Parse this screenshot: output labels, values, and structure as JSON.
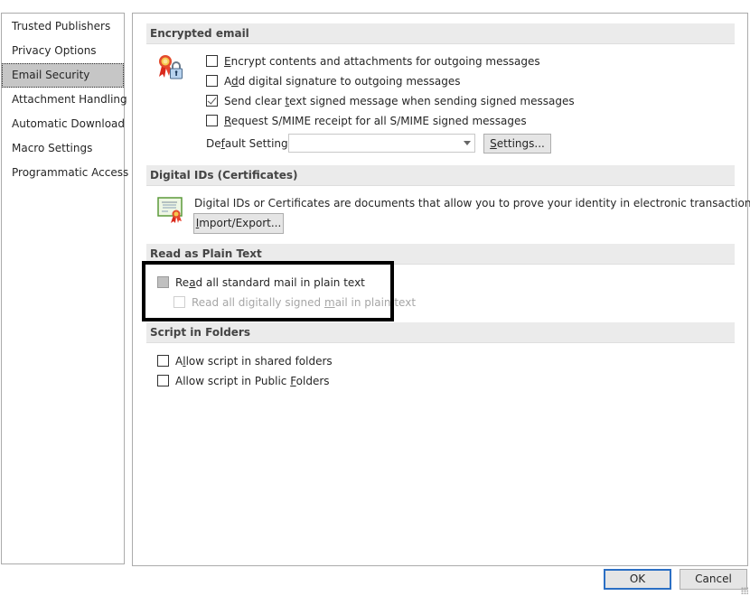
{
  "sidebar": {
    "items": [
      {
        "label": "Trusted Publishers",
        "selected": false
      },
      {
        "label": "Privacy Options",
        "selected": false
      },
      {
        "label": "Email Security",
        "selected": true
      },
      {
        "label": "Attachment Handling",
        "selected": false
      },
      {
        "label": "Automatic Download",
        "selected": false
      },
      {
        "label": "Macro Settings",
        "selected": false
      },
      {
        "label": "Programmatic Access",
        "selected": false
      }
    ]
  },
  "encrypted_email": {
    "header": "Encrypted email",
    "icon": "certificate-lock-icon",
    "options": [
      {
        "pre": "",
        "accel": "E",
        "post": "ncrypt contents and attachments for outgoing messages",
        "checked": false
      },
      {
        "pre": "A",
        "accel": "d",
        "post": "d digital signature to outgoing messages",
        "checked": false
      },
      {
        "pre": "Send clear ",
        "accel": "t",
        "post": "ext signed message when sending signed messages",
        "checked": true
      },
      {
        "pre": "",
        "accel": "R",
        "post": "equest S/MIME receipt for all S/MIME signed messages",
        "checked": false
      }
    ],
    "default_setting": {
      "pre": "De",
      "accel": "f",
      "post": "ault Setting:",
      "value": ""
    },
    "settings_button": {
      "accel": "S",
      "post": "ettings..."
    }
  },
  "digital_ids": {
    "header": "Digital IDs (Certificates)",
    "icon": "certificate-icon",
    "description": "Digital IDs or Certificates are documents that allow you to prove your identity in electronic transactions.",
    "import_export_button": {
      "accel": "I",
      "post": "mport/Export..."
    }
  },
  "plain_text": {
    "header": "Read as Plain Text",
    "options": [
      {
        "pre": "Re",
        "accel": "a",
        "post": "d all standard mail in plain text",
        "state": "indeterminate",
        "enabled": true
      },
      {
        "pre": "Read all digitally signed ",
        "accel": "m",
        "post": "ail in plain text",
        "state": "unchecked",
        "enabled": false
      }
    ]
  },
  "script_folders": {
    "header": "Script in Folders",
    "options": [
      {
        "pre": "A",
        "accel": "l",
        "post": "low script in shared folders",
        "checked": false
      },
      {
        "pre": "Allow script in Public ",
        "accel": "F",
        "post": "olders",
        "checked": false
      }
    ]
  },
  "footer": {
    "ok": "OK",
    "cancel": "Cancel"
  },
  "colors": {
    "selection": "#c6c6c6",
    "section_header_bg": "#ebebeb",
    "default_button_border": "#2b6fc4",
    "highlight": "#000000"
  }
}
